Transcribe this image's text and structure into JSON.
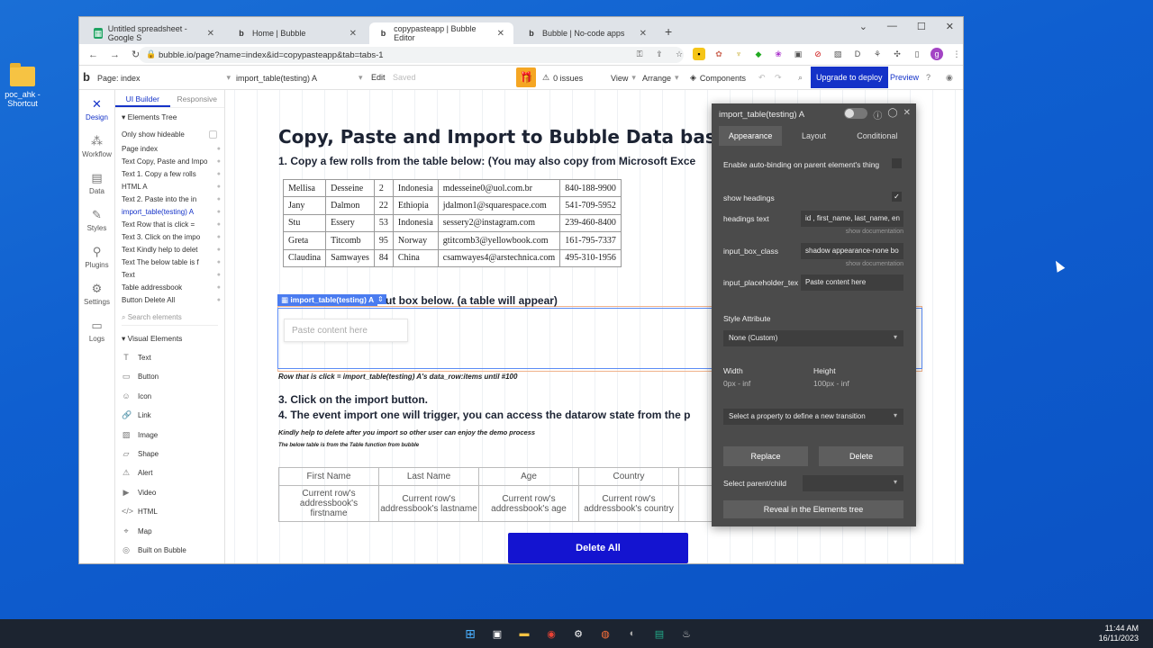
{
  "desktop": {
    "icon_label_1": "poc_ahk -",
    "icon_label_2": "Shortcut"
  },
  "tabs": [
    {
      "label": "Untitled spreadsheet - Google S",
      "icon": "sheets-icon"
    },
    {
      "label": "Home | Bubble",
      "icon": "bubble-icon"
    },
    {
      "label": "copypasteapp | Bubble Editor",
      "icon": "bubble-icon"
    },
    {
      "label": "Bubble | No-code apps",
      "icon": "bubble-icon"
    }
  ],
  "address": {
    "url": "bubble.io/page?name=index&id=copypasteapp&tab=tabs-1"
  },
  "bubblebar": {
    "page": "Page: index",
    "element": "import_table(testing) A",
    "edit": "Edit",
    "saved": "Saved",
    "issues": "0 issues",
    "view": "View",
    "arrange": "Arrange",
    "components": "Components",
    "upgrade": "Upgrade to deploy",
    "preview": "Preview"
  },
  "leftnav": [
    "Design",
    "Workflow",
    "Data",
    "Styles",
    "Plugins",
    "Settings",
    "Logs"
  ],
  "elements_panel": {
    "tab_builder": "UI Builder",
    "tab_responsive": "Responsive",
    "tree_title": "Elements Tree",
    "only_hideable": "Only show hideable",
    "items": [
      "Page index",
      "Text Copy, Paste and Impo",
      "Text 1. Copy a few rolls",
      "HTML A",
      "Text 2. Paste into the in",
      "import_table(testing) A",
      "Text Row that is click =",
      "Text 3. Click on the impo",
      "Text Kindly help to delet",
      "Text The below table is f",
      "Text",
      "Table addressbook",
      "Button Delete All"
    ],
    "search_placeholder": "Search elements",
    "visual_title": "Visual Elements",
    "visual": [
      "Text",
      "Button",
      "Icon",
      "Link",
      "Image",
      "Shape",
      "Alert",
      "Video",
      "HTML",
      "Map",
      "Built on Bubble"
    ]
  },
  "canvas": {
    "title": "Copy, Paste and Import to Bubble Data base",
    "step1": "1. Copy a few rolls from the table below: (You may also copy from Microsoft Exce",
    "table": [
      [
        "Mellisa",
        "Desseine",
        "2",
        "Indonesia",
        "mdesseine0@uol.com.br",
        "840-188-9900"
      ],
      [
        "Jany",
        "Dalmon",
        "22",
        "Ethiopia",
        "jdalmon1@squarespace.com",
        "541-709-5952"
      ],
      [
        "Stu",
        "Essery",
        "53",
        "Indonesia",
        "sessery2@instagram.com",
        "239-460-8400"
      ],
      [
        "Greta",
        "Titcomb",
        "95",
        "Norway",
        "gtitcomb3@yellowbook.com",
        "161-795-7337"
      ],
      [
        "Claudina",
        "Samwayes",
        "84",
        "China",
        "csamwayes4@arstechnica.com",
        "495-310-1956"
      ]
    ],
    "tag": "import_table(testing) A",
    "step2_tail": "ut box below. (a table will appear)",
    "paste_placeholder": "Paste content here",
    "row_click": "Row that is click = import_table(testing) A's data_row:items until #100",
    "step3": "3. Click on the import button.",
    "step4": "4. The event import one will trigger, you can access the datarow state from the p",
    "kindly": "Kindly help to delete after you import so other user can enjoy the demo process",
    "below": "The below table is from the Table function from bubble",
    "rg_headers": [
      "First Name",
      "Last Name",
      "Age",
      "Country",
      ""
    ],
    "rg_cells": [
      "Current row's addressbook's firstname",
      "Current row's addressbook's lastname",
      "Current row's addressbook's age",
      "Current row's addressbook's country",
      "Current"
    ],
    "delete_btn": "Delete All"
  },
  "prop": {
    "title": "import_table(testing) A",
    "tabs": [
      "Appearance",
      "Layout",
      "Conditional"
    ],
    "autobind": "Enable auto-binding on parent element's thing",
    "show_headings": "show headings",
    "headings_text_label": "headings text",
    "headings_text_value": "id , first_name, last_name, en",
    "show_doc": "show documentation",
    "input_box_class_label": "input_box_class",
    "input_box_class_value": "shadow appearance-none bo",
    "input_placeholder_label": "input_placeholder_tex",
    "input_placeholder_value": "Paste content here",
    "style_attr": "Style Attribute",
    "style_value": "None (Custom)",
    "width_label": "Width",
    "width_value": "0px - inf",
    "height_label": "Height",
    "height_value": "100px - inf",
    "transition": "Select a property to define a new transition",
    "replace": "Replace",
    "delete": "Delete",
    "parent_child": "Select parent/child",
    "reveal": "Reveal in the Elements tree"
  },
  "tray": {
    "time": "11:44 AM",
    "date": "16/11/2023"
  }
}
